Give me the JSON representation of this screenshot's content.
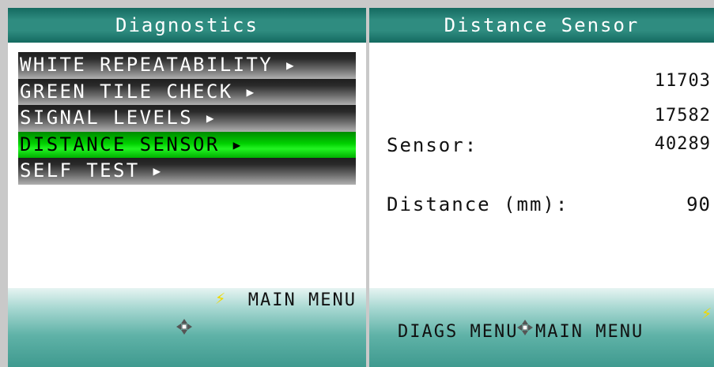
{
  "left_panel": {
    "title": "Diagnostics",
    "menu_items": [
      {
        "label": "WHITE REPEATABILITY",
        "selected": false
      },
      {
        "label": "GREEN TILE CHECK",
        "selected": false
      },
      {
        "label": "SIGNAL LEVELS",
        "selected": false
      },
      {
        "label": "DISTANCE SENSOR",
        "selected": true
      },
      {
        "label": "SELF TEST",
        "selected": false
      }
    ],
    "arrow_glyph": "▶",
    "footer": {
      "main_menu_label": "MAIN MENU",
      "lightning_icon": "lightning-icon",
      "dpad_icon": "dpad-icon"
    }
  },
  "right_panel": {
    "title": "Distance Sensor",
    "readings": [
      "11703",
      "17582",
      "40289"
    ],
    "sensor_label": "Sensor:",
    "distance_label": "Distance (mm):",
    "distance_value": "90",
    "footer": {
      "diags_menu_label": "DIAGS MENU",
      "main_menu_label": "MAIN MENU",
      "lightning_icon": "lightning-icon",
      "dpad_icon": "dpad-icon"
    }
  },
  "colors": {
    "titlebar": "#2f8c80",
    "selected_item": "#22f422",
    "menu_item": "#6e6e6e",
    "lightning": "#f0d800",
    "footer": "#5fb2a7"
  }
}
